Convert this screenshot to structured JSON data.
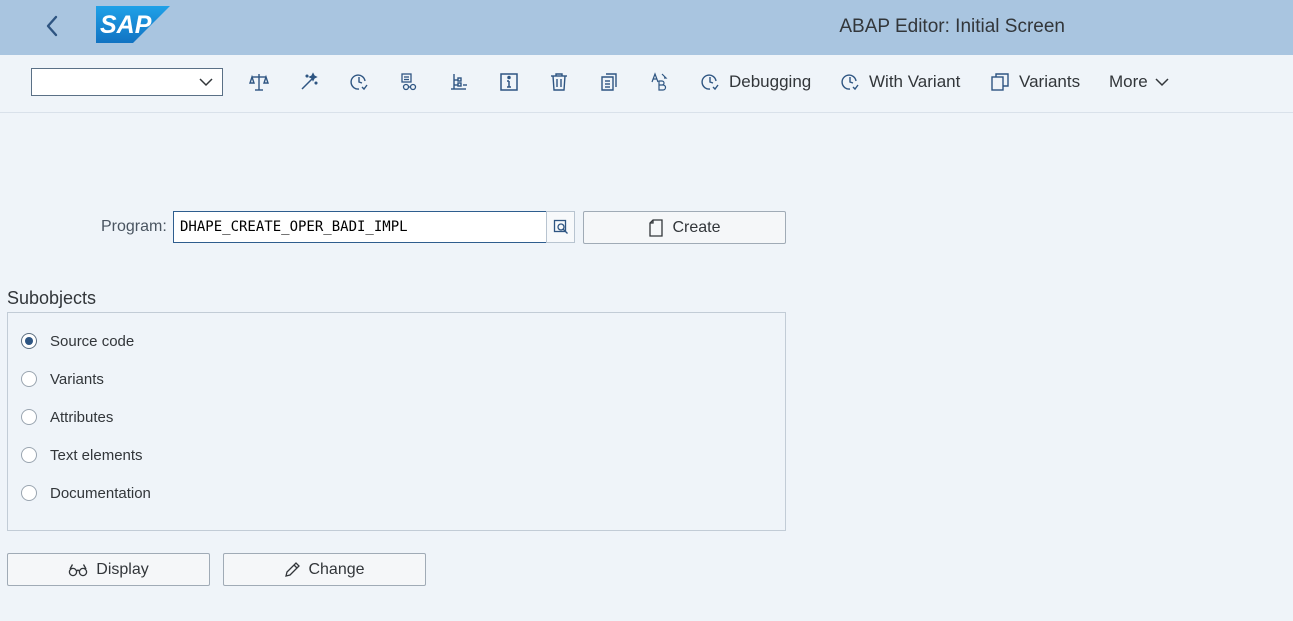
{
  "header": {
    "logo_text": "SAP",
    "title": "ABAP Editor: Initial Screen",
    "back_icon": "chevron-left-icon"
  },
  "toolbar": {
    "select_value": "",
    "icons": [
      "check-icon",
      "activate-icon",
      "test-icon",
      "where-used-icon",
      "object-list-icon",
      "info-icon",
      "delete-icon",
      "copy-icon",
      "rename-icon"
    ],
    "debugging_label": "Debugging",
    "with_variant_label": "With Variant",
    "variants_label": "Variants",
    "more_label": "More"
  },
  "program": {
    "label": "Program:",
    "value": "DHAPE_CREATE_OPER_BADI_IMPL",
    "create_label": "Create"
  },
  "subobjects": {
    "title": "Subobjects",
    "options": [
      {
        "label": "Source code",
        "selected": true
      },
      {
        "label": "Variants",
        "selected": false
      },
      {
        "label": "Attributes",
        "selected": false
      },
      {
        "label": "Text elements",
        "selected": false
      },
      {
        "label": "Documentation",
        "selected": false
      }
    ]
  },
  "actions": {
    "display_label": "Display",
    "change_label": "Change"
  },
  "colors": {
    "shell_bg": "#a9c5e0",
    "page_bg": "#eff4f9",
    "accent": "#2e5582",
    "logo_blue": "#1f8fd8"
  }
}
